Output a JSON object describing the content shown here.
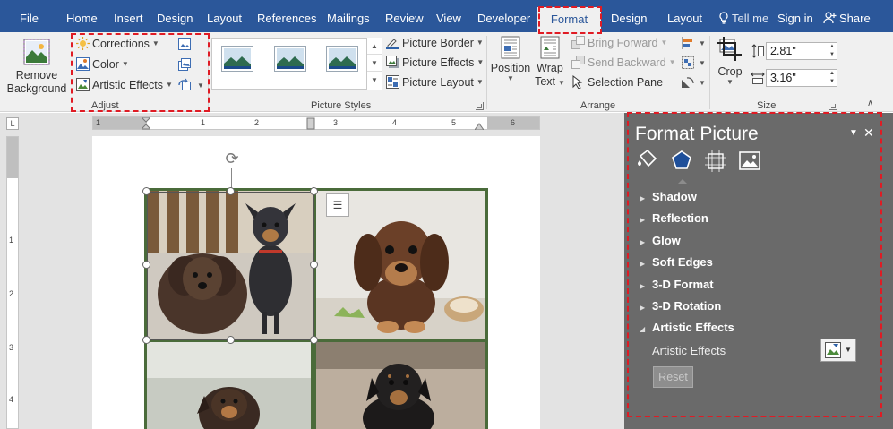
{
  "tabs": [
    {
      "label": "File"
    },
    {
      "label": "Home"
    },
    {
      "label": "Insert"
    },
    {
      "label": "Design"
    },
    {
      "label": "Layout"
    },
    {
      "label": "References"
    },
    {
      "label": "Mailings"
    },
    {
      "label": "Review"
    },
    {
      "label": "View"
    },
    {
      "label": "Developer"
    },
    {
      "label": "Format"
    },
    {
      "label": "Design"
    },
    {
      "label": "Layout"
    }
  ],
  "topright": {
    "tell_me": "Tell me",
    "sign_in": "Sign in",
    "share": "Share"
  },
  "ribbon": {
    "remove_background_line1": "Remove",
    "remove_background_line2": "Background",
    "adjust": {
      "corrections": "Corrections",
      "color": "Color",
      "artistic_effects": "Artistic Effects",
      "label": "Adjust"
    },
    "picture_styles": {
      "label": "Picture Styles",
      "border": "Picture Border",
      "effects": "Picture Effects",
      "layout": "Picture Layout"
    },
    "arrange": {
      "position": "Position",
      "wrap_text_line1": "Wrap",
      "wrap_text_line2": "Text",
      "bring_forward": "Bring Forward",
      "send_backward": "Send Backward",
      "selection_pane": "Selection Pane",
      "label": "Arrange"
    },
    "size": {
      "crop": "Crop",
      "height": "2.81\"",
      "width": "3.16\"",
      "label": "Size"
    }
  },
  "ruler": {
    "h_ticks": [
      "1",
      "1",
      "2",
      "3",
      "4",
      "5",
      "6"
    ],
    "v_ticks": [
      "1",
      "2",
      "3",
      "4"
    ]
  },
  "pane": {
    "title": "Format Picture",
    "sections": [
      {
        "label": "Shadow",
        "expanded": false
      },
      {
        "label": "Reflection",
        "expanded": false
      },
      {
        "label": "Glow",
        "expanded": false
      },
      {
        "label": "Soft Edges",
        "expanded": false
      },
      {
        "label": "3-D Format",
        "expanded": false
      },
      {
        "label": "3-D Rotation",
        "expanded": false
      },
      {
        "label": "Artistic Effects",
        "expanded": true
      }
    ],
    "artistic_effects_label": "Artistic Effects",
    "reset": "Reset"
  },
  "colors": {
    "title_bar": "#2b579a",
    "ribbon": "#f0f0f0",
    "pane": "#6a6a6a",
    "highlight": "#e01b24",
    "photo_frame": "#4a6b3a"
  }
}
